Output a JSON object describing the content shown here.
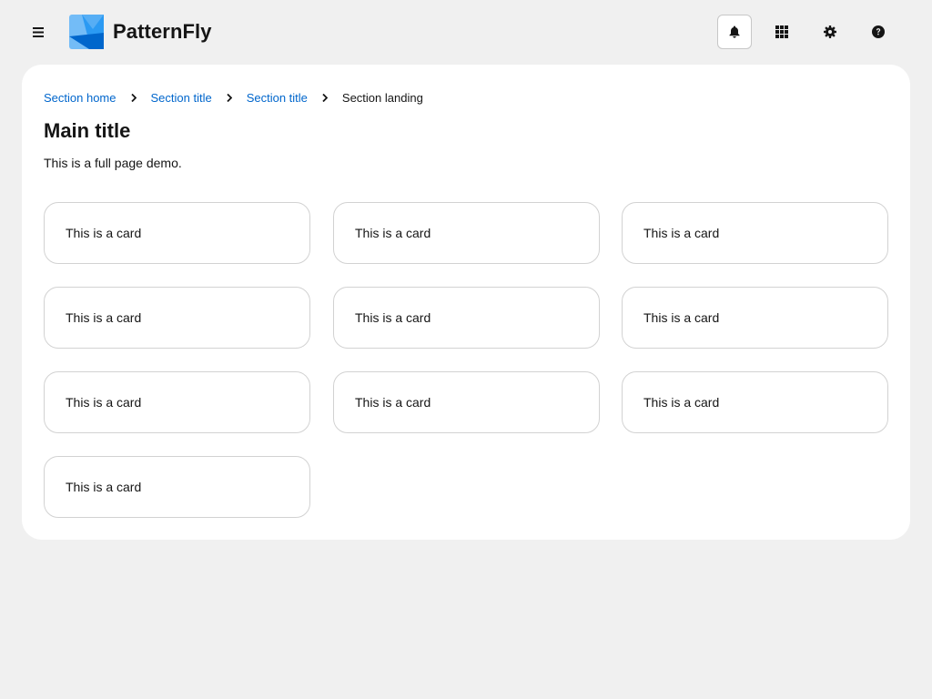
{
  "masthead": {
    "brand": "PatternFly",
    "brand_colors": {
      "light": "#73bcf7",
      "mid": "#2b9af3",
      "dark": "#0066cc"
    },
    "icons": {
      "menu": "hamburger-icon",
      "notifications": "bell-icon",
      "apps": "grid-icon",
      "settings": "gear-icon",
      "help": "question-circle-icon"
    }
  },
  "breadcrumb": {
    "items": [
      {
        "label": "Section home",
        "link": true
      },
      {
        "label": "Section title",
        "link": true
      },
      {
        "label": "Section title",
        "link": true
      },
      {
        "label": "Section landing",
        "link": false
      }
    ]
  },
  "page": {
    "title": "Main title",
    "description": "This is a full page demo."
  },
  "cards": [
    {
      "label": "This is a card"
    },
    {
      "label": "This is a card"
    },
    {
      "label": "This is a card"
    },
    {
      "label": "This is a card"
    },
    {
      "label": "This is a card"
    },
    {
      "label": "This is a card"
    },
    {
      "label": "This is a card"
    },
    {
      "label": "This is a card"
    },
    {
      "label": "This is a card"
    },
    {
      "label": "This is a card"
    }
  ],
  "colors": {
    "link": "#0066cc",
    "text": "#151515",
    "background": "#f0f0f0",
    "surface": "#ffffff"
  }
}
